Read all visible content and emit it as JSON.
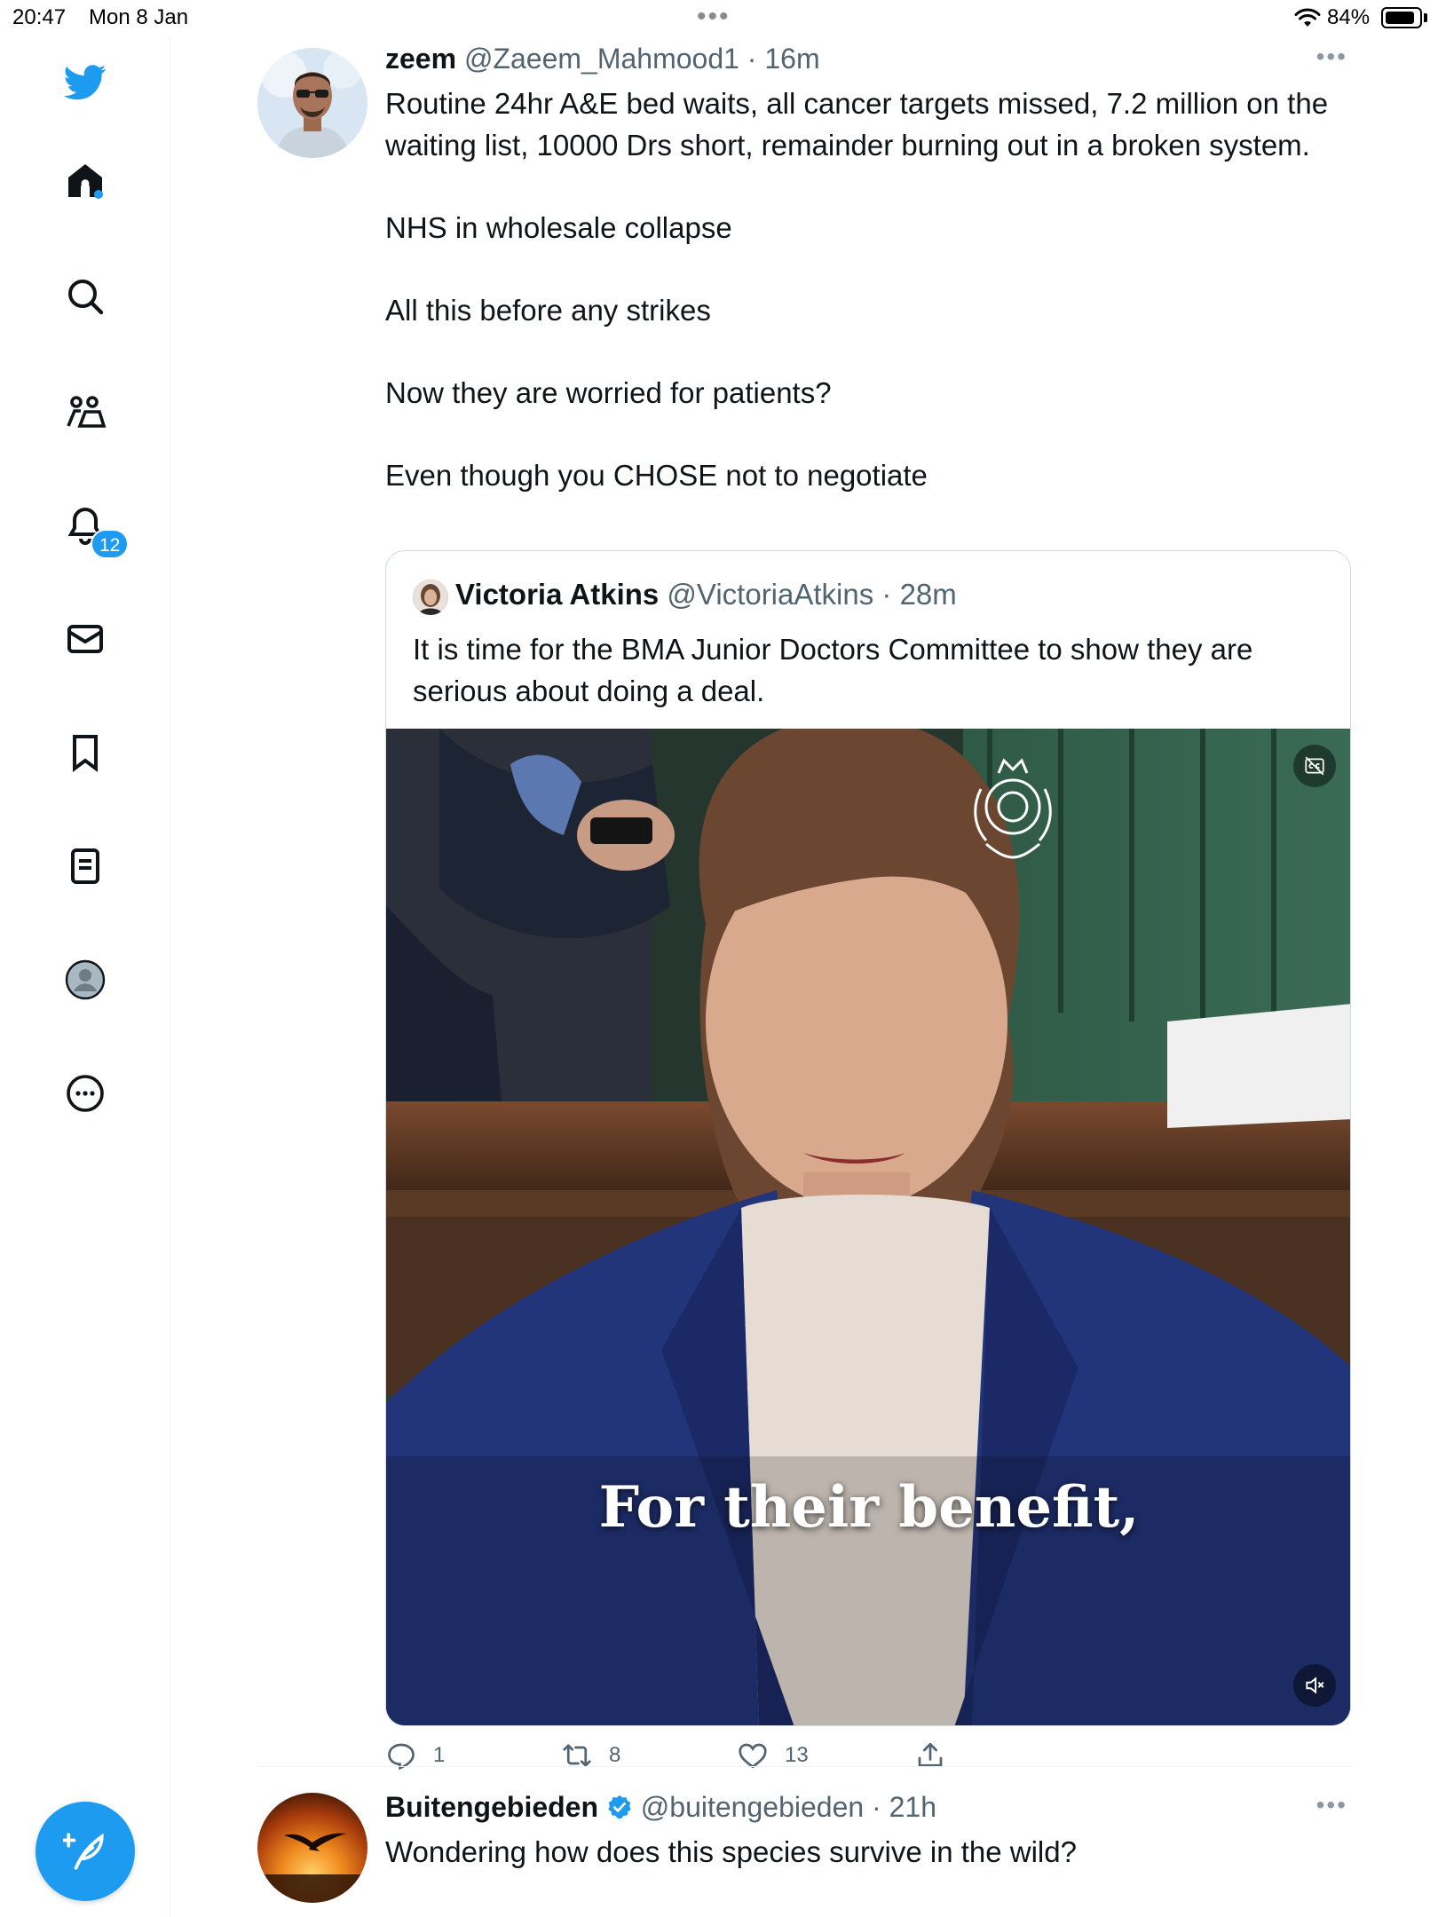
{
  "status_bar": {
    "time": "20:47",
    "date": "Mon 8 Jan",
    "battery": "84%"
  },
  "sidebar": {
    "notifications_badge": "12",
    "items": [
      "twitter-logo",
      "home-icon",
      "search-icon",
      "communities-icon",
      "bell-icon",
      "mail-icon",
      "bookmark-icon",
      "lists-icon",
      "profile-icon",
      "more-icon"
    ]
  },
  "colors": {
    "accent": "#1d9bf0",
    "text": "#0f1419",
    "secondary": "#536471",
    "border": "#cfd9de"
  },
  "tweets": [
    {
      "name": "zeem",
      "handle": "@Zaeem_Mahmood1",
      "time": "16m",
      "body": [
        "Routine 24hr A&E bed waits, all cancer targets missed, 7.2 million on the waiting list, 10000 Drs short, remainder burning out in a broken system.",
        "",
        "NHS in wholesale collapse",
        "",
        "All this before any strikes",
        "",
        "Now they are worried for patients?",
        "",
        "Even though you CHOSE not to negotiate"
      ],
      "quote": {
        "name": "Victoria Atkins",
        "handle": "@VictoriaAtkins",
        "time": "28m",
        "body": "It is time for the BMA Junior Doctors Committee to show they are serious about doing a deal.",
        "video_caption": "For their benefit,"
      },
      "replies": "1",
      "retweets": "8",
      "likes": "13"
    },
    {
      "name": "Buitengebieden",
      "handle": "@buitengebieden",
      "time": "21h",
      "verified": true,
      "body": "Wondering how does this species survive in the wild?"
    }
  ]
}
